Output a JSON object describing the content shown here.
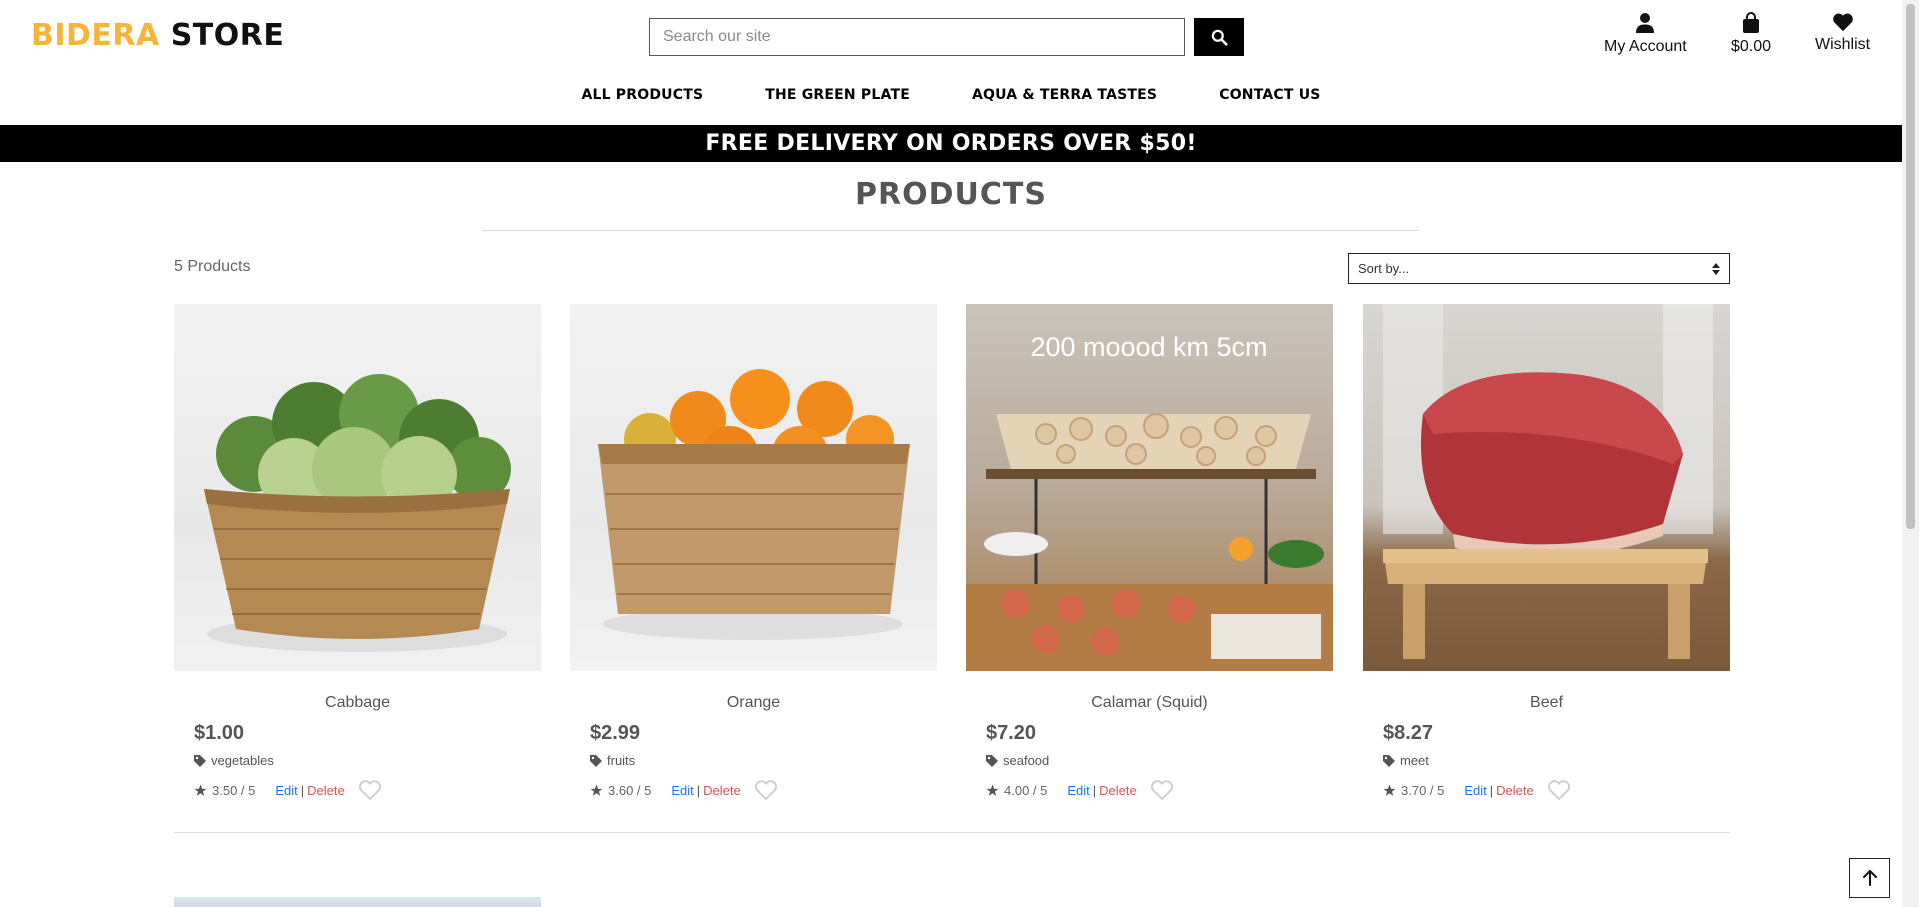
{
  "header": {
    "logo_part1": "BIDERA",
    "logo_part2": "STORE",
    "search_placeholder": "Search our site",
    "account_label": "My Account",
    "bag_total": "$0.00",
    "wishlist_label": "Wishlist"
  },
  "nav": [
    "ALL PRODUCTS",
    "THE GREEN PLATE",
    "AQUA & TERRA TASTES",
    "CONTACT US"
  ],
  "banner": "FREE DELIVERY ON ORDERS OVER $50!",
  "main": {
    "title": "PRODUCTS",
    "count": "5 Products",
    "sort_selected": "Sort by..."
  },
  "products": [
    {
      "name": "Cabbage",
      "price": "$1.00",
      "category": "vegetables",
      "rating": "3.50 / 5",
      "edit": "Edit",
      "sep": "|",
      "delete": "Delete"
    },
    {
      "name": "Orange",
      "price": "$2.99",
      "category": "fruits",
      "rating": "3.60 / 5",
      "edit": "Edit",
      "sep": "|",
      "delete": "Delete"
    },
    {
      "name": "Calamar (Squid)",
      "price": "$7.20",
      "category": "seafood",
      "rating": "4.00 / 5",
      "edit": "Edit",
      "sep": "|",
      "delete": "Delete",
      "image_text": "200 moood km 5cm"
    },
    {
      "name": "Beef",
      "price": "$8.27",
      "category": "meet",
      "rating": "3.70 / 5",
      "edit": "Edit",
      "sep": "|",
      "delete": "Delete"
    }
  ],
  "colors": {
    "accent": "#f6b43b",
    "link": "#1a73e8",
    "danger": "#d9534f",
    "banner_bg": "#000000"
  },
  "icons": [
    "search-icon",
    "user-icon",
    "shopping-bag-icon",
    "heart-icon",
    "tag-icon",
    "star-icon",
    "heart-outline-icon",
    "arrow-up-icon",
    "chevron-updown-icon"
  ]
}
